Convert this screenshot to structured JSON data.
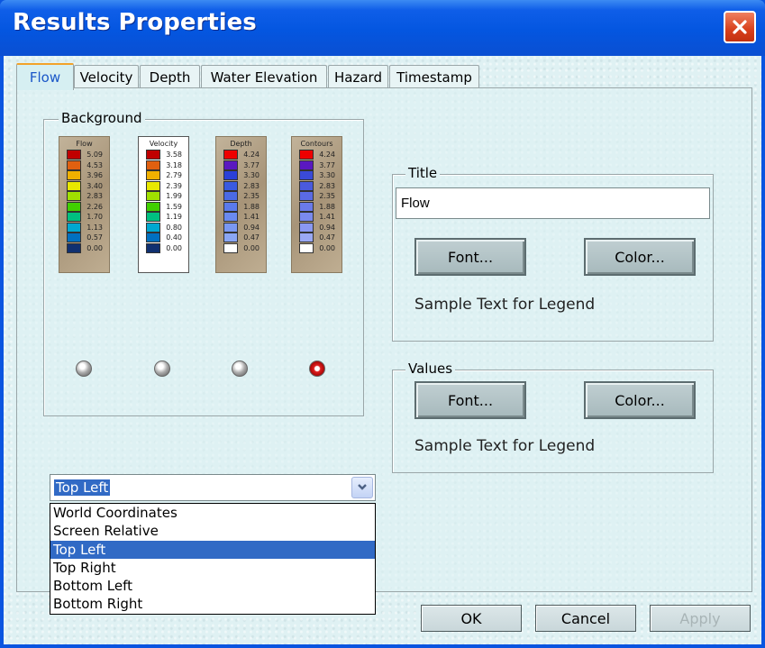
{
  "window": {
    "title": "Results Properties"
  },
  "tabs": [
    "Flow",
    "Velocity",
    "Depth",
    "Water Elevation",
    "Hazard",
    "Timestamp"
  ],
  "background": {
    "label": "Background",
    "legends": [
      {
        "title": "Flow",
        "values": [
          "5.09",
          "4.53",
          "3.96",
          "3.40",
          "2.83",
          "2.26",
          "1.70",
          "1.13",
          "0.57",
          "0.00"
        ],
        "colors": [
          "#c00000",
          "#e06010",
          "#f0b000",
          "#e8e800",
          "#a0e000",
          "#40d000",
          "#00c080",
          "#00a8d0",
          "#0070c0",
          "#103070"
        ]
      },
      {
        "title": "Velocity",
        "values": [
          "3.58",
          "3.18",
          "2.79",
          "2.39",
          "1.99",
          "1.59",
          "1.19",
          "0.80",
          "0.40",
          "0.00"
        ],
        "colors": [
          "#c00000",
          "#e06010",
          "#f0b000",
          "#e8e800",
          "#a0e000",
          "#40d000",
          "#00c080",
          "#00a8d0",
          "#0070c0",
          "#103070"
        ]
      },
      {
        "title": "Depth",
        "values": [
          "4.24",
          "3.77",
          "3.30",
          "2.83",
          "2.35",
          "1.88",
          "1.41",
          "0.94",
          "0.47",
          "0.00"
        ],
        "colors": [
          "#ee0000",
          "#5a18c0",
          "#2a40d8",
          "#3a5ae0",
          "#4a6ae6",
          "#5a7aec",
          "#6a8af0",
          "#7a98f2",
          "#8aa6f4",
          "#ffffff"
        ]
      },
      {
        "title": "Contours",
        "values": [
          "4.24",
          "3.77",
          "3.30",
          "2.83",
          "2.35",
          "1.88",
          "1.41",
          "0.94",
          "0.47",
          "0.00"
        ],
        "colors": [
          "#ee0000",
          "#5a18c0",
          "#3a4ad8",
          "#4a5ade",
          "#5a6ae4",
          "#6a7aea",
          "#7a8aee",
          "#8a98f2",
          "#9aa8f4",
          "#ffffff"
        ]
      }
    ],
    "selected_index": 3
  },
  "title_group": {
    "label": "Title",
    "value": "Flow",
    "font_label": "Font...",
    "color_label": "Color...",
    "sample": "Sample Text for Legend"
  },
  "values_group": {
    "label": "Values",
    "font_label": "Font...",
    "color_label": "Color...",
    "sample": "Sample Text for Legend"
  },
  "position": {
    "selected": "Top Left",
    "options": [
      "World Coordinates",
      "Screen Relative",
      "Top Left",
      "Top Right",
      "Bottom Left",
      "Bottom Right"
    ]
  },
  "footer": {
    "ok": "OK",
    "cancel": "Cancel",
    "apply": "Apply"
  }
}
